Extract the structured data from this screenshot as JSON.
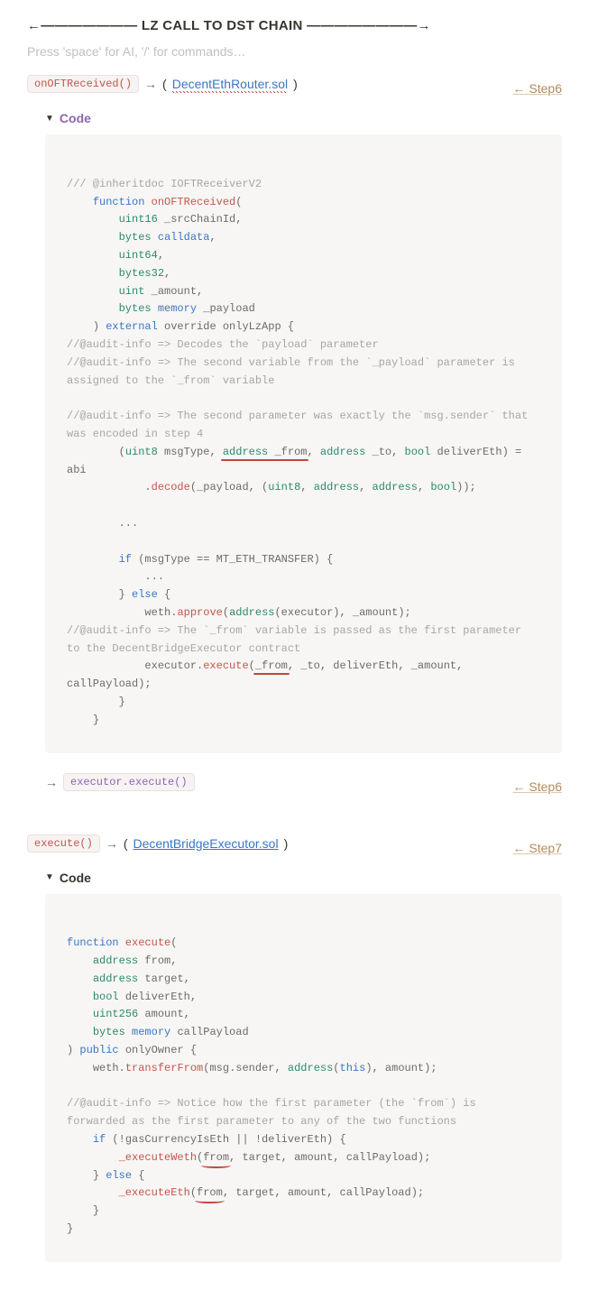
{
  "header": "←——————— LZ CALL TO DST CHAIN ————————→",
  "placeholder": "Press 'space' for AI, '/' for commands…",
  "block1": {
    "pill": "onOFTReceived()",
    "arrow": "→",
    "paren_open": "(",
    "file": "DecentEthRouter.sol",
    "paren_close": ")",
    "step": "← Step6",
    "toggle": "Code"
  },
  "code1": {
    "c01": "/// @inheritdoc IOFTReceiverV2",
    "c02a": "function",
    "c02b": "onOFTReceived",
    "c02c": "(",
    "c03a": "uint16",
    "c03b": " _srcChainId",
    "c03c": ",",
    "c04a": "bytes",
    "c04b": " calldata",
    "c04c": ",",
    "c05a": "uint64",
    "c05b": ",",
    "c06a": "bytes32",
    "c06b": ",",
    "c07a": "uint",
    "c07b": " _amount",
    "c07c": ",",
    "c08a": "bytes",
    "c08b": " memory",
    "c08c": " _payload",
    "c09a": ")",
    "c09b": "external",
    "c09c": " override onlyLzApp ",
    "c09d": "{",
    "c10": "//@audit-info => Decodes the `payload` parameter",
    "c11": "//@audit-info => The second variable from the `_payload` parameter is assigned to the `_from` variable",
    "c12": "//@audit-info => The second parameter was exactly the `msg.sender` that was encoded in step 4",
    "c13a": "(",
    "c13b": "uint8",
    "c13c": " msgType",
    "c13d": ", ",
    "c13e": "address",
    "c13f": " _from",
    "c13g": ", ",
    "c13h": "address",
    "c13i": " _to",
    "c13j": ", ",
    "c13k": "bool",
    "c13l": " deliverEth",
    "c13m": ")",
    "c13n": " = abi",
    "c14a": ".",
    "c14b": "decode",
    "c14c": "(_payload",
    "c14d": ",",
    "c14e": " (",
    "c14f": "uint8",
    "c14g": ", ",
    "c14h": "address",
    "c14i": ", ",
    "c14j": "address",
    "c14k": ", ",
    "c14l": "bool",
    "c14m": "));",
    "c15": "...",
    "c16a": "if",
    "c16b": " (msgType == MT_ETH_TRANSFER) ",
    "c16c": "{",
    "c17": "...",
    "c18a": "}",
    "c18b": " else ",
    "c18c": "{",
    "c19a": "weth",
    "c19b": ".",
    "c19c": "approve",
    "c19d": "(",
    "c19e": "address",
    "c19f": "(executor)",
    "c19g": ",",
    "c19h": " _amount);",
    "c20": "//@audit-info => The `_from` variable is passed as the first parameter to the DecentBridgeExecutor contract",
    "c21a": "executor",
    "c21b": ".",
    "c21c": "execute",
    "c21d": "(",
    "c21e": "_from",
    "c21f": ",",
    "c21g": " _to",
    "c21h": ",",
    "c21i": " deliverEth",
    "c21j": ",",
    "c21k": " _amount",
    "c21l": ",",
    "c21m": " callPayload);",
    "c22": "}",
    "c23": "}"
  },
  "row2": {
    "arrow": "→",
    "pill": "executor.execute()",
    "step": "← Step6"
  },
  "block2": {
    "pill": "execute()",
    "arrow": "→",
    "paren_open": "(",
    "file": "DecentBridgeExecutor.sol",
    "paren_close": ")",
    "step": "← Step7",
    "toggle": "Code"
  },
  "code2": {
    "d01a": "function",
    "d01b": " execute",
    "d01c": "(",
    "d02a": "address",
    "d02b": " from",
    "d02c": ",",
    "d03a": "address",
    "d03b": " target",
    "d03c": ",",
    "d04a": "bool",
    "d04b": " deliverEth",
    "d04c": ",",
    "d05a": "uint256",
    "d05b": " amount",
    "d05c": ",",
    "d06a": "bytes",
    "d06b": " memory",
    "d06c": " callPayload",
    "d07a": ")",
    "d07b": " public",
    "d07c": " onlyOwner ",
    "d07d": "{",
    "d08a": "weth",
    "d08b": ".",
    "d08c": "transferFrom",
    "d08d": "(msg",
    "d08e": ".",
    "d08f": "sender",
    "d08g": ",",
    "d08h": " address",
    "d08i": "(",
    "d08j": "this",
    "d08k": ")",
    "d08l": ",",
    "d08m": " amount);",
    "d09": "//@audit-info => Notice how the first parameter (the `from`) is forwarded as the first parameter to any of the two functions",
    "d10a": "if",
    "d10b": " (!gasCurrencyIsEth || !deliverEth) ",
    "d10c": "{",
    "d11a": "_executeWeth",
    "d11b": "(",
    "d11c": "from",
    "d11d": ",",
    "d11e": " target",
    "d11f": ",",
    "d11g": " amount",
    "d11h": ",",
    "d11i": " callPayload);",
    "d12a": "}",
    "d12b": " else ",
    "d12c": "{",
    "d13a": "_executeEth",
    "d13b": "(",
    "d13c": "from",
    "d13d": ",",
    "d13e": " target",
    "d13f": ",",
    "d13g": " amount",
    "d13h": ",",
    "d13i": " callPayload);",
    "d14": "}",
    "d15": "}"
  }
}
